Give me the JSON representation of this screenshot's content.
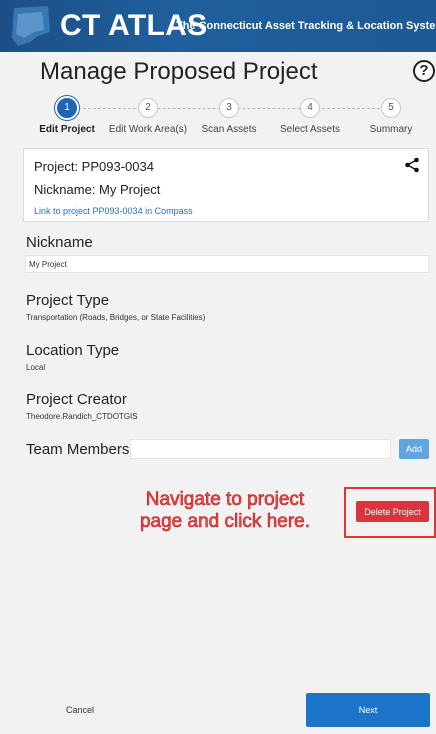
{
  "header": {
    "app_title": "CT ATLAS",
    "app_subtitle": "The Connecticut Asset Tracking & Location System"
  },
  "page": {
    "title": "Manage Proposed Project",
    "help_glyph": "?"
  },
  "stepper": {
    "steps": [
      {
        "number": "1",
        "label": "Edit Project",
        "active": true
      },
      {
        "number": "2",
        "label": "Edit Work Area(s)",
        "active": false
      },
      {
        "number": "3",
        "label": "Scan Assets",
        "active": false
      },
      {
        "number": "4",
        "label": "Select Assets",
        "active": false
      },
      {
        "number": "5",
        "label": "Summary",
        "active": false
      }
    ]
  },
  "project_card": {
    "project": "Project: PP093-0034",
    "nickname": "Nickname: My Project",
    "link": "Link to project PP093-0034 in Compass",
    "share_icon": "share-icon"
  },
  "form": {
    "nickname_label": "Nickname",
    "nickname_value": "My Project",
    "project_type_label": "Project Type",
    "project_type_value": "Transportation (Roads, Bridges, or State Facilities)",
    "location_type_label": "Location Type",
    "location_type_value": "Local",
    "project_creator_label": "Project Creator",
    "project_creator_value": "Theodore.Randich_CTDOTGIS",
    "team_members_label": "Team Members",
    "team_members_value": "",
    "add_label": "Add"
  },
  "annotation": {
    "line1": "Navigate to project",
    "line2": "page and click here.",
    "color": "#e53333"
  },
  "actions": {
    "delete_label": "Delete Project",
    "cancel_label": "Cancel",
    "next_label": "Next"
  },
  "colors": {
    "header_blue": "#1d4f86",
    "accent_blue": "#1e66b3",
    "delete_red": "#d9343f"
  }
}
